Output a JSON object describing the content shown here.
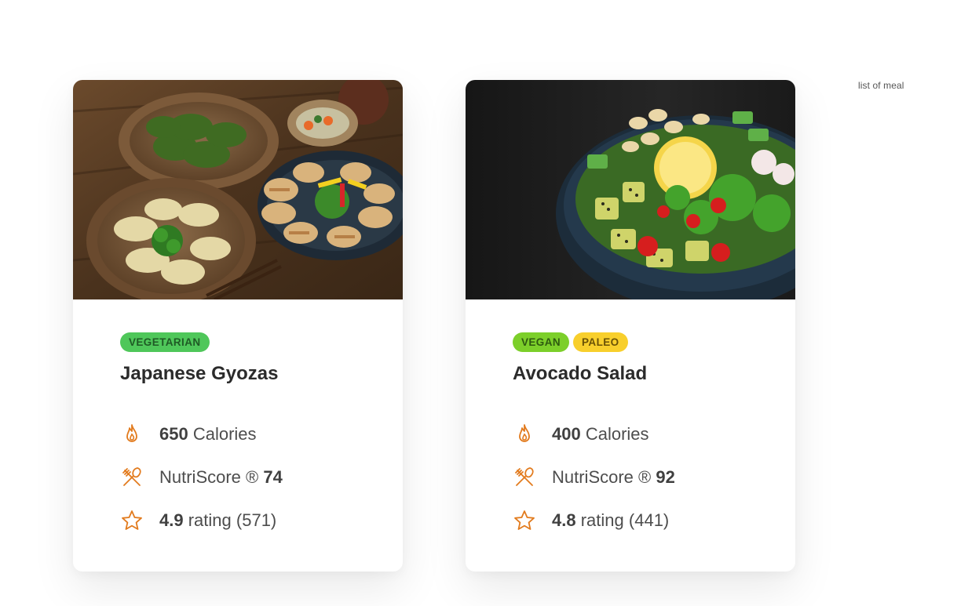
{
  "page": {
    "label": "list of meal"
  },
  "colors": {
    "accent": "#e27b1e",
    "vegetarian_tag": "#4fc75a",
    "vegan_tag": "#7ccf2a",
    "paleo_tag": "#f8cf2c"
  },
  "meals": [
    {
      "image_icon": "gyoza-photo",
      "tags": [
        "VEGETARIAN"
      ],
      "title": "Japanese Gyozas",
      "calories": {
        "value": "650",
        "unit": "Calories",
        "icon": "flame-icon"
      },
      "nutriscore": {
        "label": "NutriScore ®",
        "value": "74",
        "icon": "fork-knife-icon"
      },
      "rating": {
        "value": "4.9",
        "label": "rating",
        "count": "(571)",
        "icon": "star-icon"
      }
    },
    {
      "image_icon": "salad-photo",
      "tags": [
        "VEGAN",
        "PALEO"
      ],
      "title": "Avocado Salad",
      "calories": {
        "value": "400",
        "unit": "Calories",
        "icon": "flame-icon"
      },
      "nutriscore": {
        "label": "NutriScore ®",
        "value": "92",
        "icon": "fork-knife-icon"
      },
      "rating": {
        "value": "4.8",
        "label": "rating",
        "count": "(441)",
        "icon": "star-icon"
      }
    }
  ]
}
